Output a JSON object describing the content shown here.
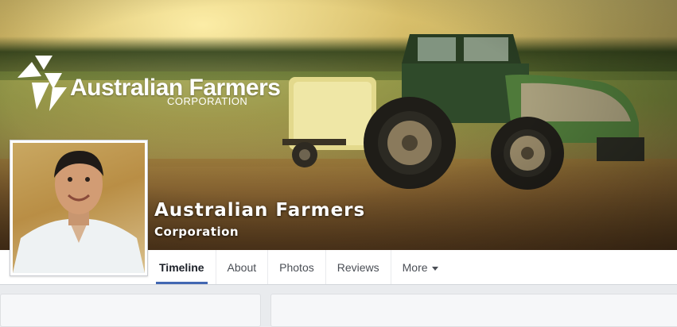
{
  "cover": {
    "logo_title": "Australian Farmers",
    "logo_subtitle": "CORPORATION"
  },
  "page": {
    "name": "Australian Farmers",
    "category": "Corporation"
  },
  "tabs": [
    {
      "label": "Timeline",
      "active": true
    },
    {
      "label": "About",
      "active": false
    },
    {
      "label": "Photos",
      "active": false
    },
    {
      "label": "Reviews",
      "active": false
    },
    {
      "label": "More",
      "active": false
    }
  ],
  "colors": {
    "accent": "#4267b2",
    "tab_text": "#4b4f56",
    "background": "#e9ebee"
  }
}
